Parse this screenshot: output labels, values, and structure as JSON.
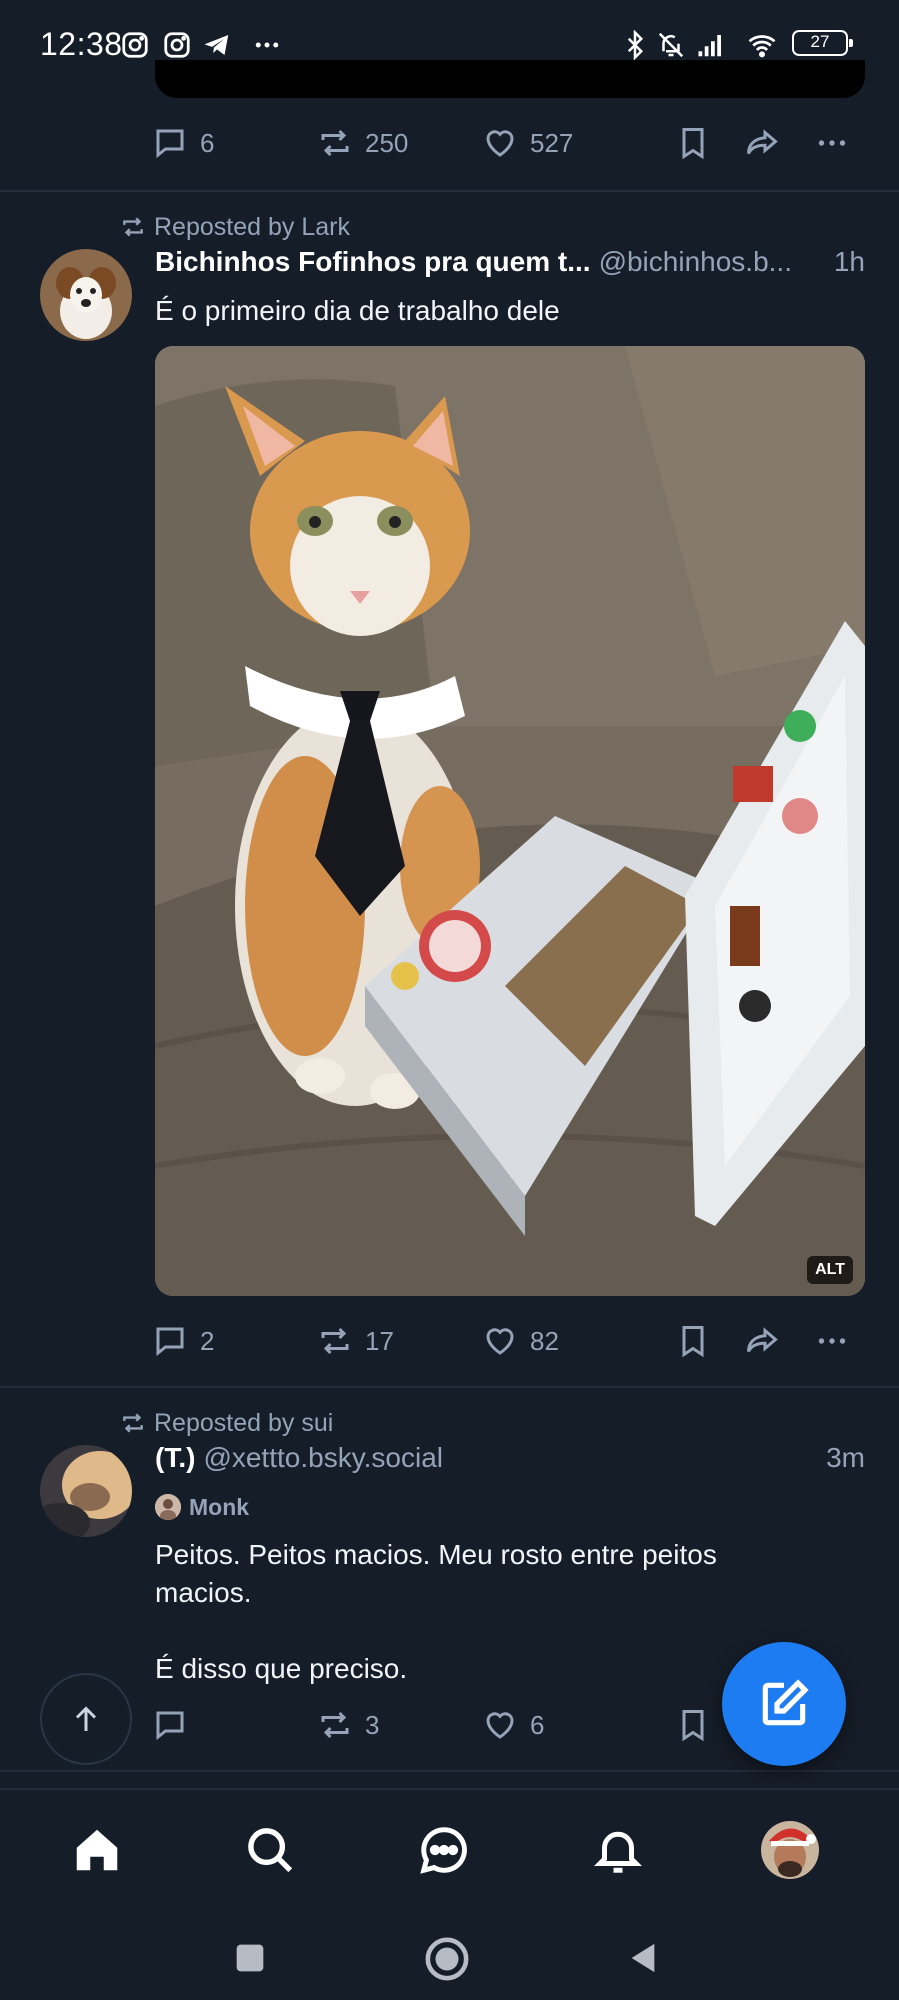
{
  "status_bar": {
    "time": "12:38",
    "battery": "27",
    "icons_left": [
      "instagram-icon",
      "instagram-icon",
      "telegram-icon",
      "more-dots-icon"
    ],
    "icons_right": [
      "bluetooth-icon",
      "bell-off-icon",
      "signal-icon",
      "wifi-icon",
      "battery-icon"
    ]
  },
  "colors": {
    "background": "#151d28",
    "muted": "#94a3b8",
    "accent": "#1d7cf2",
    "divider": "#222c3a"
  },
  "feed": {
    "previous_post": {
      "actions": {
        "replies": "6",
        "reposts": "250",
        "likes": "527"
      }
    },
    "post1": {
      "repost_label": "Reposted by Lark",
      "author_name": "Bichinhos Fofinhos pra quem t...",
      "handle": "@bichinhos.b...",
      "time": "1h",
      "text": "É o primeiro dia de trabalho dele",
      "image_alt_badge": "ALT",
      "actions": {
        "replies": "2",
        "reposts": "17",
        "likes": "82"
      }
    },
    "post2": {
      "repost_label": "Reposted by sui",
      "author_name": "(T.)",
      "handle": "@xettto.bsky.social",
      "time": "3m",
      "badge_label": "Monk",
      "text_line1": "Peitos. Peitos macios. Meu rosto entre peitos",
      "text_line2": "macios.",
      "text_line3": "É disso que preciso.",
      "actions": {
        "replies": "",
        "reposts": "3",
        "likes": "6"
      }
    }
  },
  "bottom_nav": {
    "items": [
      "home-icon",
      "search-icon",
      "chat-icon",
      "notifications-icon",
      "profile-avatar"
    ]
  },
  "system_nav": [
    "recents-button",
    "home-button",
    "back-button"
  ]
}
